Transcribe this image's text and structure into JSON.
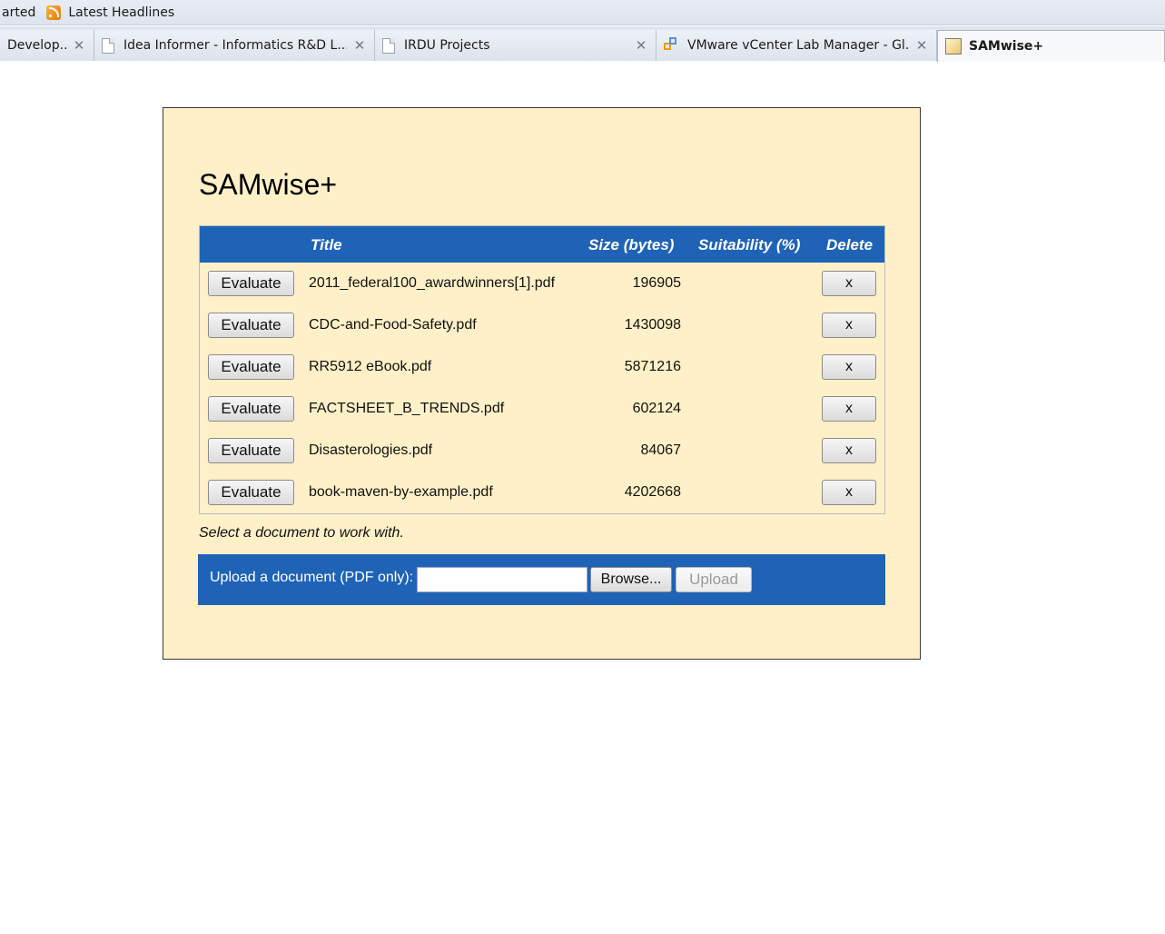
{
  "bookmarks_bar": {
    "items": [
      {
        "label": "arted"
      },
      {
        "label": "Latest Headlines",
        "icon": "rss-feed-icon"
      }
    ]
  },
  "tabs": [
    {
      "label": "Develop...",
      "icon": "none"
    },
    {
      "label": "Idea Informer - Informatics R&D L...",
      "icon": "page-icon"
    },
    {
      "label": "IRDU Projects",
      "icon": "page-icon"
    },
    {
      "label": "VMware vCenter Lab Manager - Gl...",
      "icon": "vmware-icon"
    },
    {
      "label": "SAMwise+",
      "icon": "samwise-icon",
      "active": true
    }
  ],
  "app": {
    "title": "SAMwise+",
    "table": {
      "headers": {
        "title": "Title",
        "size": "Size (bytes)",
        "suitability": "Suitability (%)",
        "delete": "Delete"
      },
      "evaluate_label": "Evaluate",
      "delete_label": "x",
      "rows": [
        {
          "title": "2011_federal100_awardwinners[1].pdf",
          "size": "196905",
          "suitability": ""
        },
        {
          "title": "CDC-and-Food-Safety.pdf",
          "size": "1430098",
          "suitability": ""
        },
        {
          "title": "RR5912 eBook.pdf",
          "size": "5871216",
          "suitability": ""
        },
        {
          "title": "FACTSHEET_B_TRENDS.pdf",
          "size": "602124",
          "suitability": ""
        },
        {
          "title": "Disasterologies.pdf",
          "size": "84067",
          "suitability": ""
        },
        {
          "title": "book-maven-by-example.pdf",
          "size": "4202668",
          "suitability": ""
        }
      ]
    },
    "helper_text": "Select a document to work with.",
    "upload": {
      "label": "Upload a document (PDF only):",
      "file_value": "",
      "browse_label": "Browse...",
      "upload_label": "Upload"
    }
  },
  "colors": {
    "panel_background": "#fff0c8",
    "header_blue": "#1f63b6"
  }
}
